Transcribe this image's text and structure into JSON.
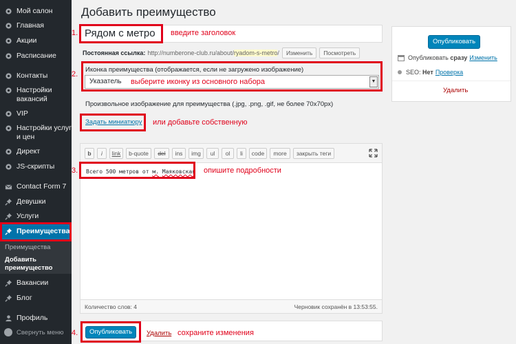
{
  "sidebar": {
    "items": [
      {
        "label": "Мой салон",
        "icon": "gear-icon"
      },
      {
        "label": "Главная",
        "icon": "gear-icon"
      },
      {
        "label": "Акции",
        "icon": "gear-icon"
      },
      {
        "label": "Расписание",
        "icon": "gear-icon"
      },
      {
        "label": "Контакты",
        "icon": "gear-icon"
      },
      {
        "label": "Настройки вакансий",
        "icon": "gear-icon"
      },
      {
        "label": "VIP",
        "icon": "gear-icon"
      },
      {
        "label": "Настройки услуг и цен",
        "icon": "gear-icon"
      },
      {
        "label": "Директ",
        "icon": "gear-icon"
      },
      {
        "label": "JS-скрипты",
        "icon": "gear-icon"
      },
      {
        "label": "Contact Form 7",
        "icon": "mail-icon"
      },
      {
        "label": "Девушки",
        "icon": "pin-icon"
      },
      {
        "label": "Услуги",
        "icon": "pin-icon"
      },
      {
        "label": "Преимущества",
        "icon": "pin-icon"
      },
      {
        "label": "Вакансии",
        "icon": "pin-icon"
      },
      {
        "label": "Блог",
        "icon": "pin-icon"
      },
      {
        "label": "Профиль",
        "icon": "user-icon"
      }
    ],
    "submenu": [
      "Преимущества",
      "Добавить преимущество"
    ],
    "collapse": "Свернуть меню"
  },
  "main": {
    "title": "Добавить преимущество",
    "post_title": "Рядом с метро",
    "permalink_label": "Постоянная ссылка:",
    "permalink_base": "http://numberone-club.ru/about/",
    "permalink_slug": "ryadom-s-metro",
    "permalink_end": "/",
    "btn_edit": "Изменить",
    "btn_view": "Посмотреть",
    "icon_label": "Иконка преимущества (отображается, если не загружено изображение)",
    "icon_select": "Указатель",
    "custom_image_label": "Произвольное изображение для преимущества (.jpg, .png, .gif, не более 70x70px)",
    "thumb_link": "Задать миниатюру"
  },
  "editor": {
    "buttons": [
      "b",
      "i",
      "link",
      "b-quote",
      "del",
      "ins",
      "img",
      "ul",
      "ol",
      "li",
      "code",
      "more",
      "закрыть теги"
    ],
    "content_before": "Всего 500 метров от ",
    "content_sp1": "м.",
    "content_mid": " ",
    "content_sp2": "Маяковская",
    "word_count": "Количество слов: 4",
    "draft_saved": "Черновик сохранён в 13:53:55."
  },
  "bottom": {
    "publish": "Опубликовать",
    "delete": "Удалить"
  },
  "side_box": {
    "publish": "Опубликовать",
    "publish_when": "Опубликовать",
    "publish_when_bold": "сразу",
    "change": "Изменить",
    "seo_label": "SEO:",
    "seo_value": "Нет",
    "seo_link": "Проверка",
    "delete": "Удалить"
  },
  "annotations": {
    "n1": "1.",
    "a1": "введите заголовок",
    "n2": "2.",
    "a2": "выберите иконку из основного набора",
    "a_thumb": "или добавьте собственную",
    "n3": "3.",
    "a3": "опишите подробности",
    "n4": "4.",
    "a4": "сохраните изменения"
  },
  "colors": {
    "accent": "#0073aa",
    "annotation": "#e0001a",
    "sidebar": "#23282d"
  }
}
